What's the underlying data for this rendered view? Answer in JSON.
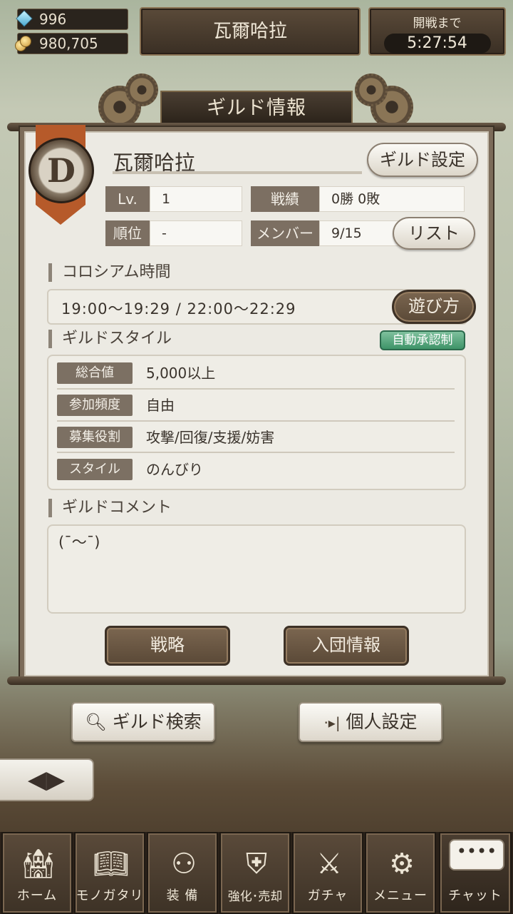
{
  "currency": {
    "gems": "996",
    "gold": "980,705"
  },
  "header": {
    "guild_name": "瓦爾哈拉",
    "battle_label": "開戦まで",
    "battle_timer": "5:27:54"
  },
  "panel": {
    "title": "ギルド情報",
    "emblem_letter": "D",
    "guild_name": "瓦爾哈拉",
    "settings_button": "ギルド設定",
    "stats": {
      "level_label": "Lv.",
      "level_value": "1",
      "record_label": "戦績",
      "record_value": "0勝 0敗",
      "rank_label": "順位",
      "rank_value": "-",
      "member_label": "メンバー",
      "member_value": "9/15",
      "list_button": "リスト"
    },
    "colosseum": {
      "title": "コロシアム時間",
      "times": "19:00〜19:29 / 22:00〜22:29",
      "howto_button": "遊び方"
    },
    "style": {
      "title": "ギルドスタイル",
      "badge": "自動承認制",
      "rows": [
        {
          "label": "総合値",
          "value": "5,000以上"
        },
        {
          "label": "参加頻度",
          "value": "自由"
        },
        {
          "label": "募集役割",
          "value": "攻撃/回復/支援/妨害"
        },
        {
          "label": "スタイル",
          "value": "のんびり"
        }
      ]
    },
    "comment": {
      "title": "ギルドコメント",
      "text": "(¯～¯)"
    },
    "buttons": {
      "strategy": "戦略",
      "join_info": "入団情報"
    }
  },
  "actions": {
    "search": "ギルド検索",
    "personal": "個人設定"
  },
  "nav": [
    {
      "label": "ホーム",
      "icon": "castle-icon"
    },
    {
      "label": "モノガタリ",
      "icon": "book-icon"
    },
    {
      "label": "装 備",
      "icon": "puppet-icon"
    },
    {
      "label": "強化･売却",
      "icon": "shield-sword-icon"
    },
    {
      "label": "ガチャ",
      "icon": "crossed-swords-icon"
    },
    {
      "label": "メニュー",
      "icon": "gears-icon"
    },
    {
      "label": "チャット",
      "icon": "chat-icon"
    }
  ]
}
